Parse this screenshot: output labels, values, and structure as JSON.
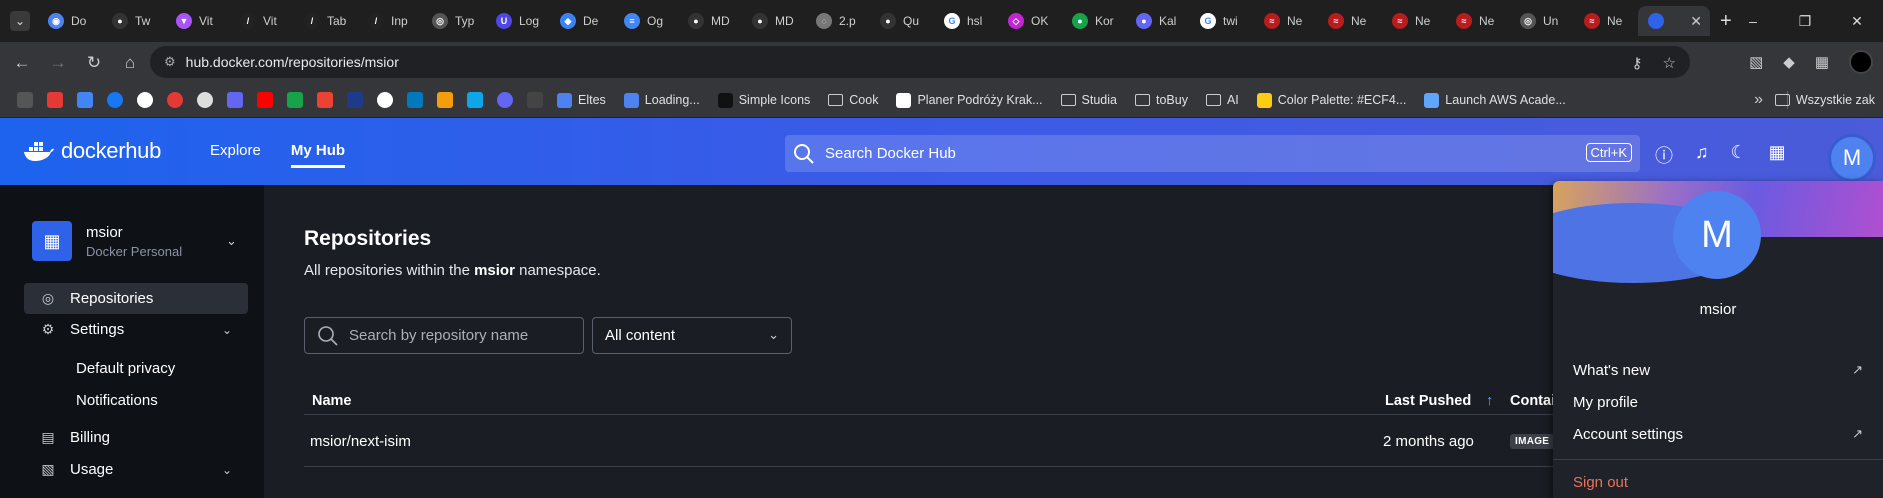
{
  "browser": {
    "tabs": [
      {
        "label": "Do",
        "color": "#4d82f0",
        "glyph": "◉"
      },
      {
        "label": "Tw",
        "color": "#333",
        "glyph": "●"
      },
      {
        "label": "Vit",
        "color": "#a855f7",
        "glyph": "▼"
      },
      {
        "label": "Vit",
        "color": "#222",
        "glyph": "/"
      },
      {
        "label": "Tab",
        "color": "#222",
        "glyph": "/"
      },
      {
        "label": "Inp",
        "color": "#222",
        "glyph": "/"
      },
      {
        "label": "Typ",
        "color": "#555",
        "glyph": "◎"
      },
      {
        "label": "Log",
        "color": "#4f46e5",
        "glyph": "U"
      },
      {
        "label": "De",
        "color": "#3b82f6",
        "glyph": "◆"
      },
      {
        "label": "Og",
        "color": "#4285f4",
        "glyph": "≡"
      },
      {
        "label": "MD",
        "color": "#333",
        "glyph": "●"
      },
      {
        "label": "MD",
        "color": "#333",
        "glyph": "●"
      },
      {
        "label": "2.p",
        "color": "#777",
        "glyph": "◌"
      },
      {
        "label": "Qu",
        "color": "#333",
        "glyph": "●"
      },
      {
        "label": "hsl",
        "color": "#fff",
        "glyph": "G"
      },
      {
        "label": "OK",
        "color": "#c026d3",
        "glyph": "◇"
      },
      {
        "label": "Kor",
        "color": "#16a34a",
        "glyph": "●"
      },
      {
        "label": "Kal",
        "color": "#6366f1",
        "glyph": "●"
      },
      {
        "label": "twi",
        "color": "#fff",
        "glyph": "G"
      },
      {
        "label": "Ne",
        "color": "#b91c1c",
        "glyph": "≈"
      },
      {
        "label": "Ne",
        "color": "#b91c1c",
        "glyph": "≈"
      },
      {
        "label": "Ne",
        "color": "#b91c1c",
        "glyph": "≈"
      },
      {
        "label": "Ne",
        "color": "#b91c1c",
        "glyph": "≈"
      },
      {
        "label": "Un",
        "color": "#555",
        "glyph": "◎"
      },
      {
        "label": "Ne",
        "color": "#b91c1c",
        "glyph": "≈"
      }
    ],
    "active_tab_close": "✕",
    "new_tab": "+",
    "window_controls": [
      "–",
      "❐",
      "✕"
    ],
    "url": "hub.docker.com/repositories/msior",
    "bookmarks": [
      {
        "label": "Eltes",
        "color": "#4d82f0"
      },
      {
        "label": "Loading...",
        "color": "#4d82f0"
      },
      {
        "label": "Simple Icons",
        "color": "#111"
      },
      {
        "label": "Cook",
        "folder": true
      },
      {
        "label": "Planer Podróży Krak...",
        "color": "#fff"
      },
      {
        "label": "Studia",
        "folder": true
      },
      {
        "label": "toBuy",
        "folder": true
      },
      {
        "label": "AI",
        "folder": true
      },
      {
        "label": "Color Palette: #ECF4...",
        "color": "#facc15"
      },
      {
        "label": "Launch AWS Acade...",
        "color": "#60a5fa"
      }
    ],
    "bookmark_overflow": "»",
    "other_bookmarks": "Wszystkie zak"
  },
  "header": {
    "logo_light": "docker",
    "logo_bold": "hub",
    "nav": [
      {
        "label": "Explore",
        "active": false
      },
      {
        "label": "My Hub",
        "active": true
      }
    ],
    "search_placeholder": "Search Docker Hub",
    "search_shortcut": "Ctrl+K",
    "avatar_letter": "M"
  },
  "sidebar": {
    "org_name": "msior",
    "org_type": "Docker Personal",
    "items": [
      {
        "label": "Repositories",
        "active": true
      },
      {
        "label": "Settings",
        "expandable": true
      },
      {
        "label": "Default privacy",
        "sub": true
      },
      {
        "label": "Notifications",
        "sub": true
      },
      {
        "label": "Billing"
      },
      {
        "label": "Usage",
        "expandable": true
      }
    ]
  },
  "main": {
    "title": "Repositories",
    "subtitle_prefix": "All repositories within the ",
    "subtitle_namespace": "msior",
    "subtitle_suffix": " namespace.",
    "search_placeholder": "Search by repository name",
    "filter_value": "All content",
    "columns": {
      "name": "Name",
      "last_pushed": "Last Pushed",
      "contains": "Contains"
    },
    "sort_indicator": "↑",
    "rows": [
      {
        "name": "msior/next-isim",
        "last_pushed": "2 months ago",
        "contains": "IMAGE"
      }
    ]
  },
  "user_menu": {
    "avatar_letter": "M",
    "username": "msior",
    "items": [
      {
        "label": "What's new",
        "external": true
      },
      {
        "label": "My profile",
        "external": false
      },
      {
        "label": "Account settings",
        "external": true
      }
    ],
    "sign_out": "Sign out"
  }
}
